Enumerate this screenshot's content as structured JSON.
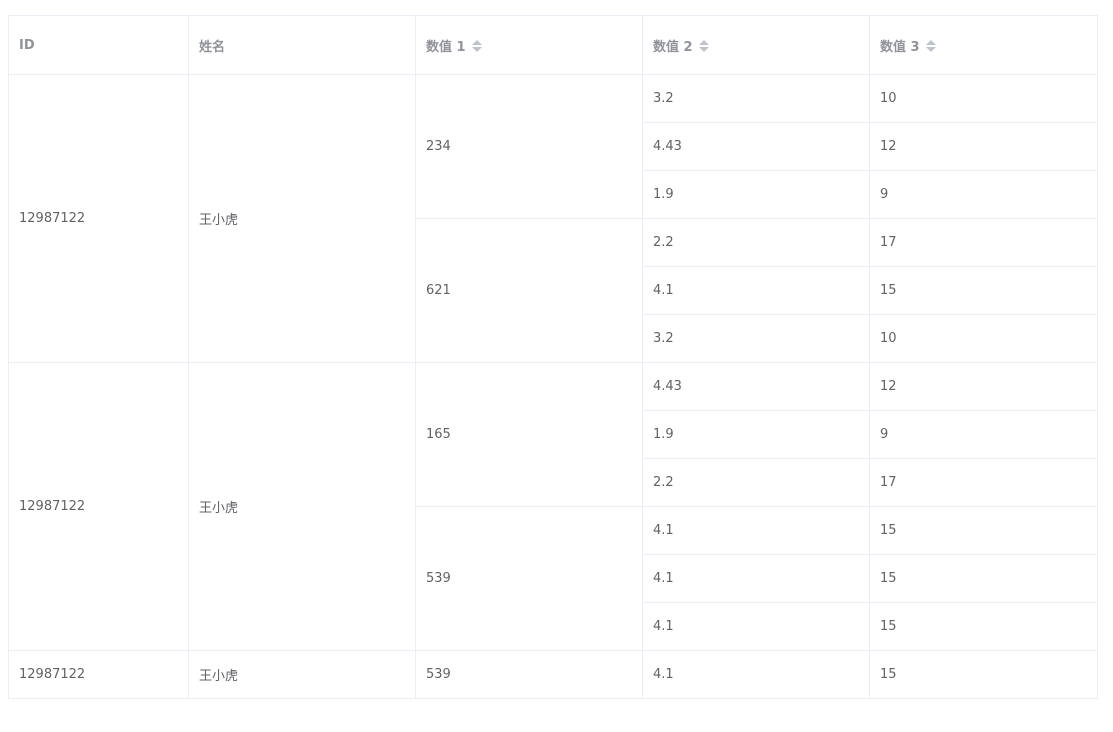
{
  "table": {
    "headers": {
      "id": "ID",
      "name": "姓名",
      "amount1": "数值 1",
      "amount2": "数值 2",
      "amount3": "数值 3"
    },
    "groups": [
      {
        "id": "12987122",
        "name": "王小虎",
        "subgroups": [
          {
            "amount1": "234",
            "rows": [
              {
                "amount2": "3.2",
                "amount3": "10"
              },
              {
                "amount2": "4.43",
                "amount3": "12"
              },
              {
                "amount2": "1.9",
                "amount3": "9"
              }
            ]
          },
          {
            "amount1": "621",
            "rows": [
              {
                "amount2": "2.2",
                "amount3": "17"
              },
              {
                "amount2": "4.1",
                "amount3": "15"
              },
              {
                "amount2": "3.2",
                "amount3": "10"
              }
            ]
          }
        ]
      },
      {
        "id": "12987122",
        "name": "王小虎",
        "subgroups": [
          {
            "amount1": "165",
            "rows": [
              {
                "amount2": "4.43",
                "amount3": "12"
              },
              {
                "amount2": "1.9",
                "amount3": "9"
              },
              {
                "amount2": "2.2",
                "amount3": "17"
              }
            ]
          },
          {
            "amount1": "539",
            "rows": [
              {
                "amount2": "4.1",
                "amount3": "15"
              },
              {
                "amount2": "4.1",
                "amount3": "15"
              },
              {
                "amount2": "4.1",
                "amount3": "15"
              }
            ]
          }
        ]
      },
      {
        "id": "12987122",
        "name": "王小虎",
        "subgroups": [
          {
            "amount1": "539",
            "rows": [
              {
                "amount2": "4.1",
                "amount3": "15"
              }
            ]
          }
        ]
      }
    ],
    "icons": {
      "sort": "sort-caret-icon"
    },
    "colors": {
      "border": "#ebeef5",
      "header_text": "#909399",
      "cell_text": "#606266",
      "caret": "#c0c4cc"
    }
  }
}
